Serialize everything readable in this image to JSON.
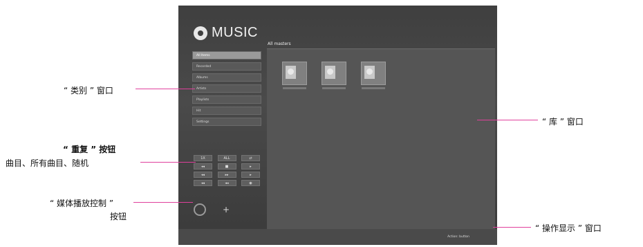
{
  "app": {
    "logo_text": "MUSIC",
    "view_title": "All masters",
    "categories": [
      "All Items",
      "Recorded",
      "Albums",
      "Artists",
      "Playlists",
      "Hit",
      "Settings"
    ],
    "controls": [
      [
        "1X",
        "ALL",
        "⇄"
      ],
      [
        "◂◂",
        "■",
        "▸"
      ],
      [
        "◂◂",
        "▸▸",
        "▸"
      ],
      [
        "◂◂",
        "◂◂",
        "◉"
      ]
    ],
    "plus_label": "+",
    "status_text": "Action: button"
  },
  "callouts": {
    "category": "“ 类别 ” 窗口",
    "repeat_title": "“ 重复 ” 按钮",
    "repeat_desc": "曲目、所有曲目、随机",
    "media_line1": "“ 媒体播放控制 ”",
    "media_line2": "按钮",
    "library": "“ 库 ” 窗口",
    "status": "“ 操作显示 ” 窗口"
  },
  "colors": {
    "callout_line": "#e0409c",
    "window_bg": "#454545"
  }
}
